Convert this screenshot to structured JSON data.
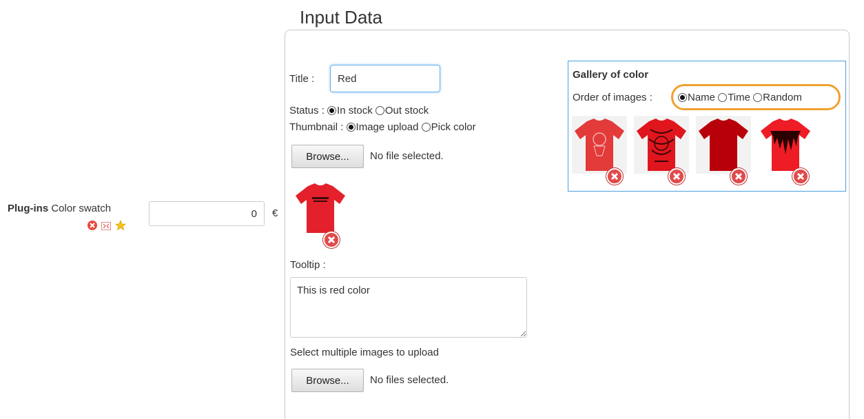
{
  "plugin": {
    "label_bold": "Plug-ins",
    "label_rest": " Color swatch",
    "price_value": "0",
    "currency": "€"
  },
  "form": {
    "legend": "Input Data",
    "title_label": "Title :",
    "title_value": "Red",
    "status_label": "Status :",
    "status_options": [
      "In stock",
      "Out stock"
    ],
    "status_selected": "In stock",
    "thumbnail_label": "Thumbnail :",
    "thumbnail_options": [
      "Image upload",
      "Pick color"
    ],
    "thumbnail_selected": "Image upload",
    "browse_label": "Browse...",
    "no_file_text": "No file selected.",
    "tooltip_label": "Tooltip :",
    "tooltip_value": "This is red color",
    "multi_label": "Select multiple images to upload",
    "browse_label_2": "Browse...",
    "no_files_text": "No files selected."
  },
  "gallery": {
    "title": "Gallery of color",
    "order_label": "Order of images :",
    "order_options": [
      "Name",
      "Time",
      "Random"
    ],
    "order_selected": "Name"
  },
  "colors": {
    "accent_blue": "#4aa0e0",
    "highlight_orange": "#f0a030",
    "shirt_red": "#e3202b",
    "delete_red": "#e04b4b"
  }
}
